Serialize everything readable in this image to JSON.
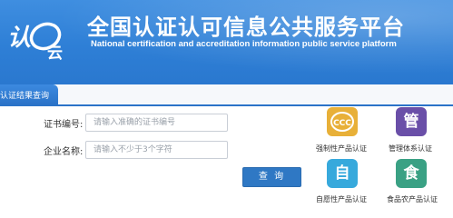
{
  "header": {
    "logo_text": "认e云",
    "title": "全国认证认可信息公共服务平台",
    "subtitle": "National certification and accreditation information public service platform",
    "background_color": "#2e7fd6"
  },
  "tab": {
    "label": "认证结果查询"
  },
  "form": {
    "cert_no": {
      "label": "证书编号:",
      "placeholder": "请输入准确的证书编号",
      "value": ""
    },
    "company": {
      "label": "企业名称:",
      "placeholder": "请输入不少于3个字符",
      "value": ""
    },
    "query_label": "查 询"
  },
  "categories": [
    {
      "label": "强制性产品认证",
      "glyph": "CCC",
      "icon": "ccc-icon",
      "color": "#e8b038"
    },
    {
      "label": "管理体系认证",
      "glyph": "管",
      "icon": "management-icon",
      "color": "#6a4fa8"
    },
    {
      "label": "自愿性产品认证",
      "glyph": "自",
      "icon": "voluntary-icon",
      "color": "#37a9dc"
    },
    {
      "label": "食品农产品认证",
      "glyph": "食",
      "icon": "food-icon",
      "color": "#3aa184"
    }
  ]
}
